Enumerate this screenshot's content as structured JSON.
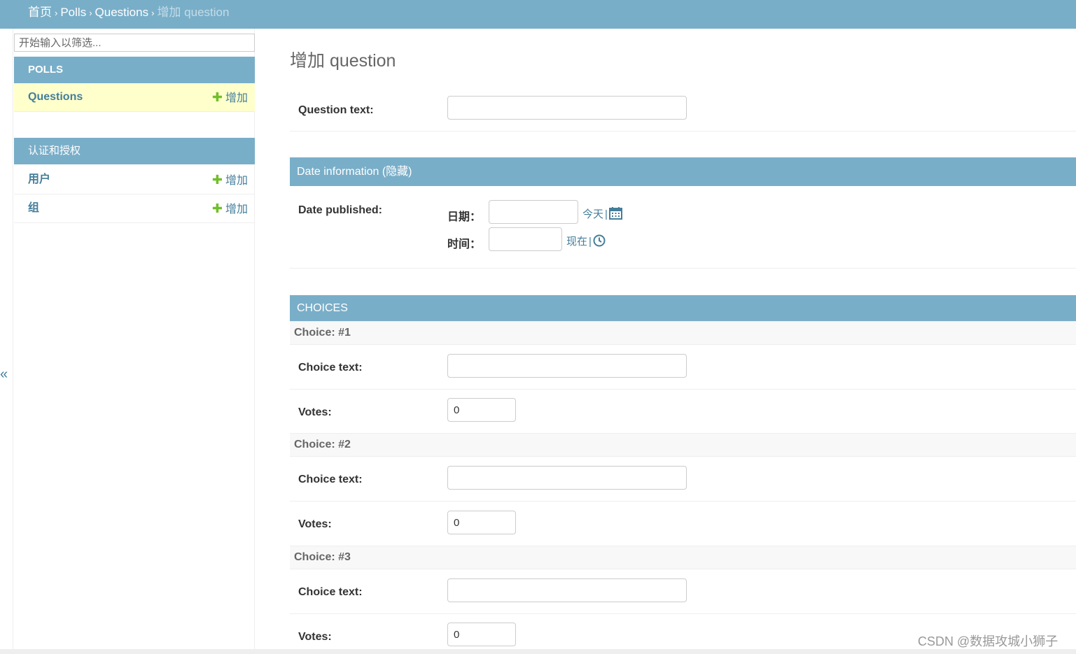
{
  "breadcrumbs": {
    "home": "首页",
    "sep": "›",
    "app": "Polls",
    "model": "Questions",
    "current": "增加 question"
  },
  "sidebar": {
    "toggle": "«",
    "filter_placeholder": "开始输入以筛选...",
    "modules": [
      {
        "caption": "POLLS",
        "items": [
          {
            "name": "Questions",
            "add": "增加",
            "active": true
          }
        ]
      },
      {
        "caption": "认证和授权",
        "items": [
          {
            "name": "用户",
            "add": "增加"
          },
          {
            "name": "组",
            "add": "增加"
          }
        ]
      }
    ]
  },
  "main": {
    "title": "增加 question",
    "question_text_label": "Question text:",
    "question_text_value": "",
    "date_fieldset": {
      "caption": "Date information (隐藏)",
      "field_label": "Date published:",
      "date_label": "日期：",
      "date_value": "",
      "today": "今天",
      "time_label": "时间：",
      "time_value": "",
      "now": "现在",
      "bar": "|"
    },
    "choices": {
      "caption": "CHOICES",
      "choice_text_label": "Choice text:",
      "votes_label": "Votes:",
      "items": [
        {
          "header": "Choice: #1",
          "text": "",
          "votes": "0"
        },
        {
          "header": "Choice: #2",
          "text": "",
          "votes": "0"
        },
        {
          "header": "Choice: #3",
          "text": "",
          "votes": "0"
        }
      ]
    }
  },
  "watermark": "CSDN @数据攻城小狮子",
  "colors": {
    "header": "#79aec8",
    "link": "#447e9b",
    "add": "#70bf2b",
    "active": "#ffffcc"
  },
  "icons": [
    "calendar-icon",
    "clock-icon",
    "plus-icon"
  ]
}
